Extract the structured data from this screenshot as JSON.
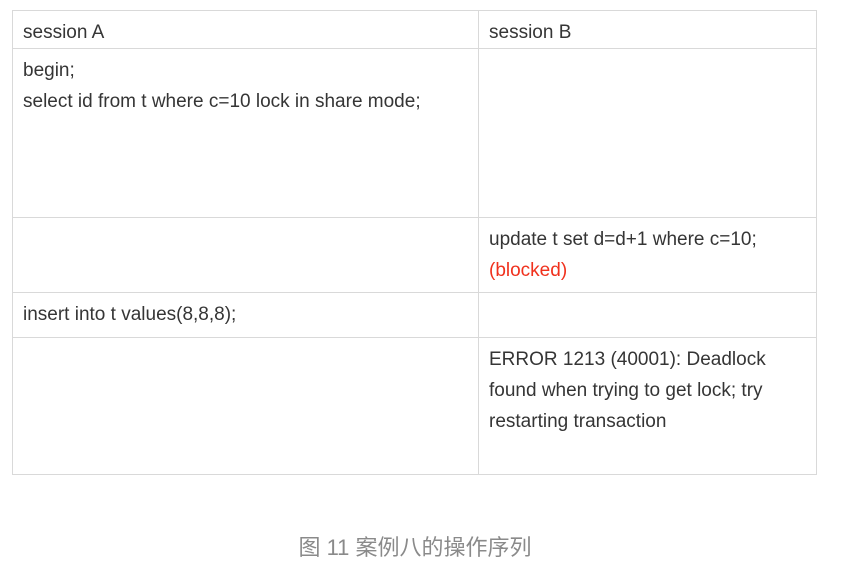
{
  "table": {
    "headers": [
      "session A",
      "session B"
    ],
    "rows": [
      {
        "a": [
          "begin;",
          "select id from t where c=10 lock in share mode;"
        ],
        "b": []
      },
      {
        "a": [],
        "b": [
          "update t set d=d+1 where c=10;"
        ],
        "b_status": "(blocked)"
      },
      {
        "a": [
          "insert into t values(8,8,8);"
        ],
        "b": []
      },
      {
        "a": [],
        "b": [
          "ERROR 1213 (40001): Deadlock found when trying to get lock; try restarting transaction"
        ]
      }
    ]
  },
  "caption": "图 11 案例八的操作序列",
  "colors": {
    "text": "#353535",
    "blocked": "#f0311d",
    "border": "#d9d9d9",
    "caption": "#8a8a8a"
  }
}
